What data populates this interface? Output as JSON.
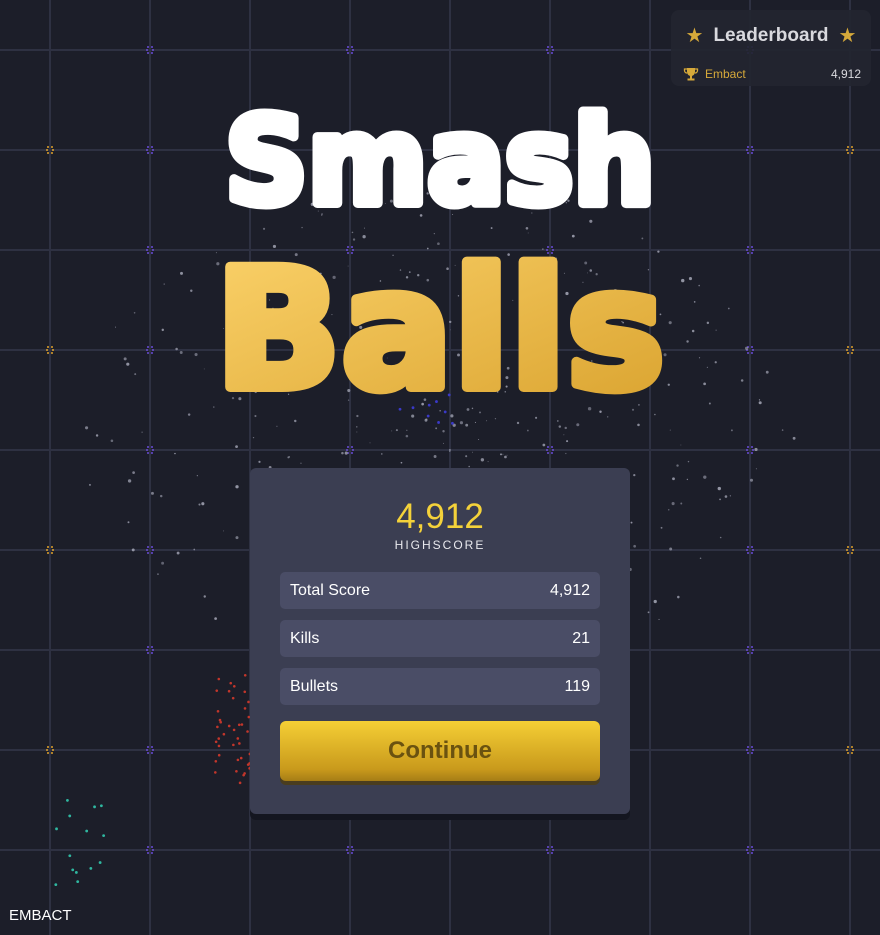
{
  "leaderboard": {
    "title": "Leaderboard",
    "star_icon": "star-icon",
    "entry": {
      "name": "Embact",
      "score": "4,912",
      "icon": "trophy-icon"
    }
  },
  "title": {
    "line1": "Smash",
    "line2": "Balls"
  },
  "panel": {
    "highscore_value": "4,912",
    "highscore_label": "HIGHSCORE",
    "stats": [
      {
        "label": "Total Score",
        "value": "4,912"
      },
      {
        "label": "Kills",
        "value": "21"
      },
      {
        "label": "Bullets",
        "value": "119"
      }
    ],
    "continue_label": "Continue"
  },
  "footer": {
    "player_name": "EMBACT"
  },
  "colors": {
    "background": "#1c1e29",
    "grid": "#2e3142",
    "accent_gold": "#f4d23a",
    "panel": "#3b3e52",
    "row": "#4a4d66"
  }
}
